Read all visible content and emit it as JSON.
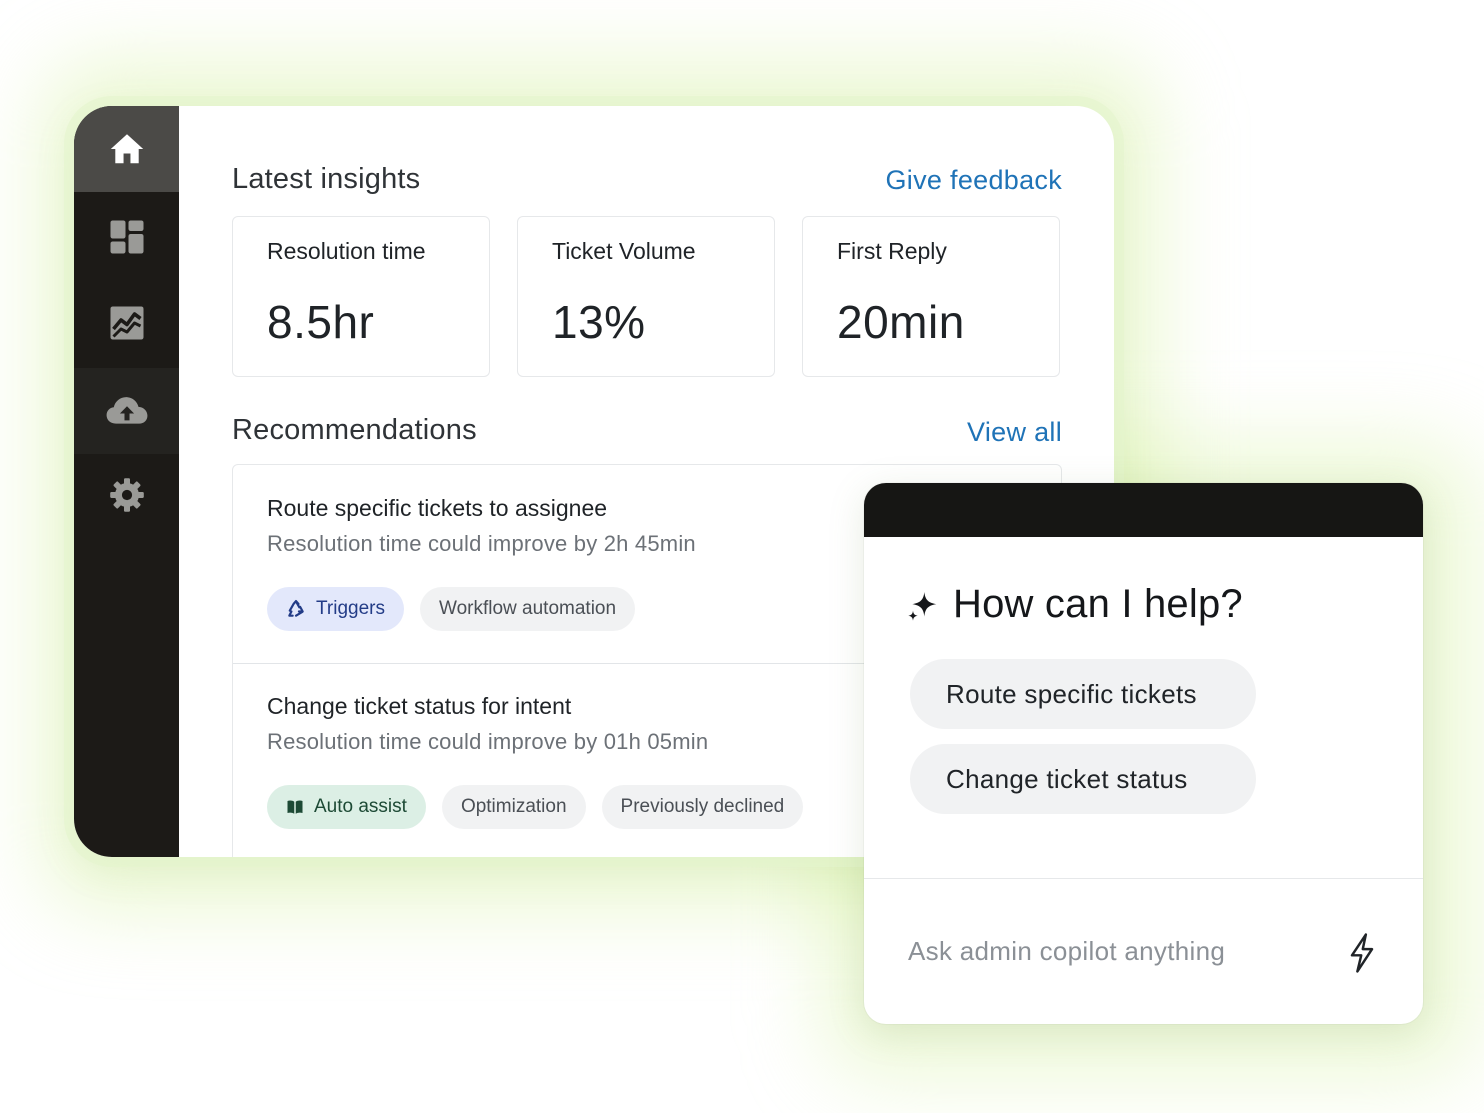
{
  "sidebar": {
    "items": [
      {
        "icon": "home-icon",
        "active": true
      },
      {
        "icon": "dashboard-icon"
      },
      {
        "icon": "reports-icon"
      },
      {
        "icon": "cloud-upload-icon"
      },
      {
        "icon": "gear-icon"
      }
    ]
  },
  "insights": {
    "title": "Latest insights",
    "feedback_link": "Give feedback",
    "cards": [
      {
        "label": "Resolution time",
        "value": "8.5hr"
      },
      {
        "label": "Ticket Volume",
        "value": "13%"
      },
      {
        "label": "First Reply",
        "value": "20min"
      }
    ]
  },
  "recommendations": {
    "title": "Recommendations",
    "view_all_link": "View all",
    "items": [
      {
        "title": "Route specific tickets to assignee",
        "subtitle": "Resolution time could improve by 2h 45min",
        "tags": [
          "Triggers",
          "Workflow automation"
        ]
      },
      {
        "title": "Change ticket status for intent",
        "subtitle": "Resolution time could improve by 01h 05min",
        "tags": [
          "Auto assist",
          "Optimization",
          "Previously declined"
        ]
      }
    ]
  },
  "copilot": {
    "heading": "How can I help?",
    "suggestions": [
      "Route specific tickets",
      "Change ticket status"
    ],
    "input_placeholder": "Ask admin copilot anything"
  },
  "colors": {
    "sidebar_bg": "#1c1a17",
    "sidebar_active": "#4b4a47",
    "link": "#1f73b7",
    "tag_triggers_bg": "#e3e8fb",
    "tag_auto_assist_bg": "#dcefe5",
    "copilot_header": "#161614"
  }
}
